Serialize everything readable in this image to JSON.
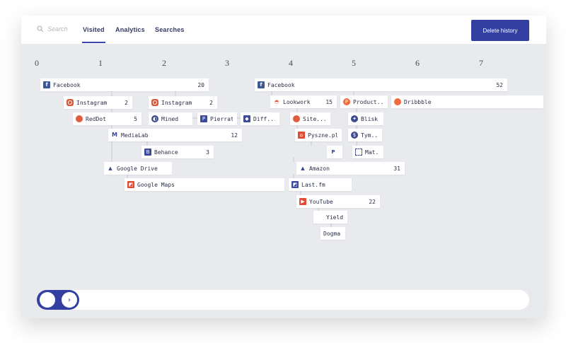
{
  "search": {
    "placeholder": "Search"
  },
  "tabs": [
    {
      "label": "Visited",
      "active": true
    },
    {
      "label": "Analytics",
      "active": false
    },
    {
      "label": "Searches",
      "active": false
    }
  ],
  "delete_button": {
    "label": "Delete history"
  },
  "columns": [
    "0",
    "1",
    "2",
    "3",
    "4",
    "5",
    "6",
    "7"
  ],
  "nodes": [
    {
      "label": "Facebook",
      "count": "20",
      "icon": "facebook-icon"
    },
    {
      "label": "Instagram",
      "count": "2",
      "icon": "instagram-icon"
    },
    {
      "label": "RedDot",
      "count": "5",
      "icon": "reddot-icon"
    },
    {
      "label": "Instagram",
      "count": "2",
      "icon": "instagram-icon"
    },
    {
      "label": "Mined",
      "count": "",
      "icon": "mined-icon"
    },
    {
      "label": "Pierrat",
      "count": "",
      "icon": "pierrat-icon"
    },
    {
      "label": "Diff...",
      "count": "",
      "icon": "diff-icon"
    },
    {
      "label": "MediaLab",
      "count": "12",
      "icon": "medialab-icon"
    },
    {
      "label": "Behance",
      "count": "3",
      "icon": "behance-icon"
    },
    {
      "label": "Google Drive",
      "count": "",
      "icon": "google-drive-icon"
    },
    {
      "label": "Google Maps",
      "count": "",
      "icon": "google-maps-icon"
    },
    {
      "label": "Facebook",
      "count": "52",
      "icon": "facebook-icon"
    },
    {
      "label": "Lookwork",
      "count": "15",
      "icon": "lookwork-icon"
    },
    {
      "label": "Site...",
      "count": "",
      "icon": "site-icon"
    },
    {
      "label": "Product..",
      "count": "",
      "icon": "product-hunt-icon"
    },
    {
      "label": "Dribbble",
      "count": "",
      "icon": "dribbble-icon"
    },
    {
      "label": "Blisk",
      "count": "",
      "icon": "blisk-icon"
    },
    {
      "label": "Pyszne.pl",
      "count": "",
      "icon": "pyszne-icon"
    },
    {
      "label": "Tym..",
      "count": "",
      "icon": "tym-icon"
    },
    {
      "label": "",
      "count": "",
      "icon": "paypal-icon"
    },
    {
      "label": "Mat..",
      "count": "",
      "icon": "mat-icon"
    },
    {
      "label": "Amazon",
      "count": "31",
      "icon": "amazon-icon"
    },
    {
      "label": "Last.fm",
      "count": "",
      "icon": "lastfm-icon"
    },
    {
      "label": "YouTube",
      "count": "22",
      "icon": "youtube-icon"
    },
    {
      "label": "Yields",
      "count": "",
      "icon": "yields-icon"
    },
    {
      "label": "Dogma",
      "count": "",
      "icon": ""
    }
  ],
  "colors": {
    "accent": "#333fa1",
    "background": "#e9eaee",
    "tab_text": "#343962"
  }
}
